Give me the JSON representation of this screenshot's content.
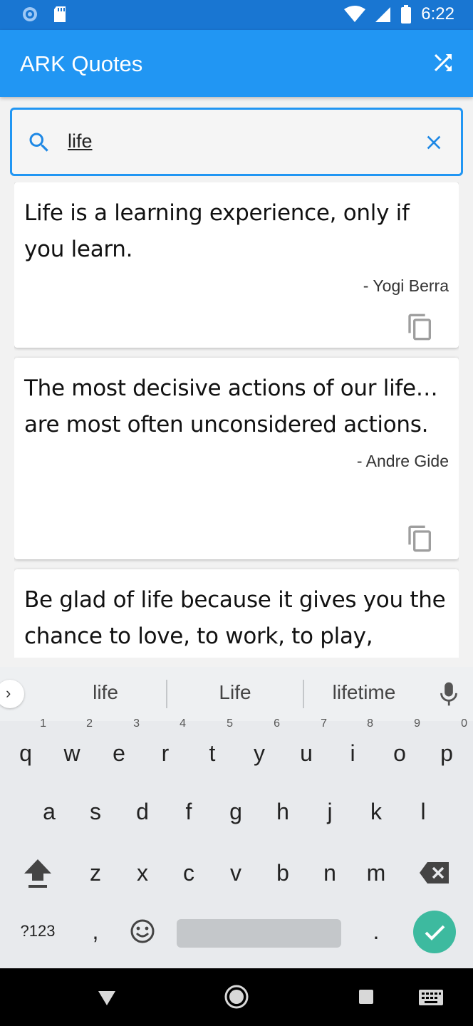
{
  "status_bar": {
    "time": "6:22"
  },
  "app_bar": {
    "title": "ARK Quotes",
    "shuffle_icon": "shuffle-icon"
  },
  "search": {
    "value": "life",
    "placeholder": ""
  },
  "quotes": [
    {
      "text": "Life is a learning experience, only if you learn.",
      "author": "- Yogi Berra"
    },
    {
      "text": "The most decisive actions of our life… are most often unconsidered actions.",
      "author": "- Andre Gide"
    },
    {
      "text": "Be glad of life because it gives you the chance to love, to work, to play,",
      "author": ""
    }
  ],
  "keyboard": {
    "suggestions": [
      "life",
      "Life",
      "lifetime"
    ],
    "row1": [
      "q",
      "w",
      "e",
      "r",
      "t",
      "y",
      "u",
      "i",
      "o",
      "p"
    ],
    "row1_hints": [
      "1",
      "2",
      "3",
      "4",
      "5",
      "6",
      "7",
      "8",
      "9",
      "0"
    ],
    "row2": [
      "a",
      "s",
      "d",
      "f",
      "g",
      "h",
      "j",
      "k",
      "l"
    ],
    "row3": [
      "z",
      "x",
      "c",
      "v",
      "b",
      "n",
      "m"
    ],
    "symbols_label": "?123",
    "comma": ",",
    "period": "."
  },
  "colors": {
    "primary": "#2196f3",
    "status_bar": "#1976d2",
    "enter_key": "#3dba9f"
  }
}
